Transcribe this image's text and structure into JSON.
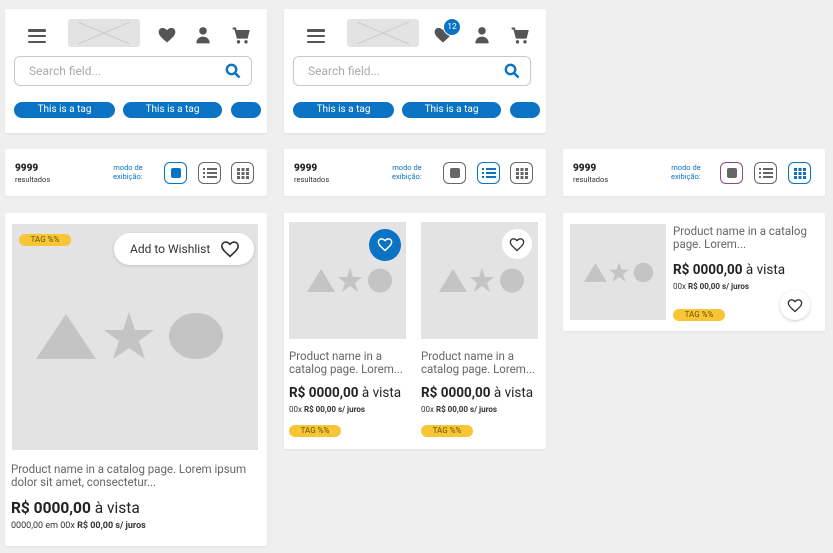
{
  "header": {
    "search_placeholder": "Search field...",
    "tag_label": "This is a tag",
    "wishlist_count": "12"
  },
  "results": {
    "count": "9999",
    "count_label": "resultados",
    "mode_label_1": "modo de",
    "mode_label_2": "exibição:"
  },
  "product": {
    "tag": "TAG %%",
    "wishlist_button": "Add to Wishlist",
    "name_long": "Product name in a catalog page. Lorem ipsum dolor sit amet, consectetur...",
    "name_short": "Product name in a catalog page. Lorem...",
    "price_value": "R$ 0000,00",
    "price_suffix": "à vista",
    "inst_large_prefix": "0000,00 em 00x",
    "inst_value": "R$ 00,00 s/ juros",
    "inst_prefix": "00x"
  },
  "colors": {
    "accent": "#0a73c4",
    "tag": "#f7c536",
    "placeholder": "#e3e3e3"
  }
}
